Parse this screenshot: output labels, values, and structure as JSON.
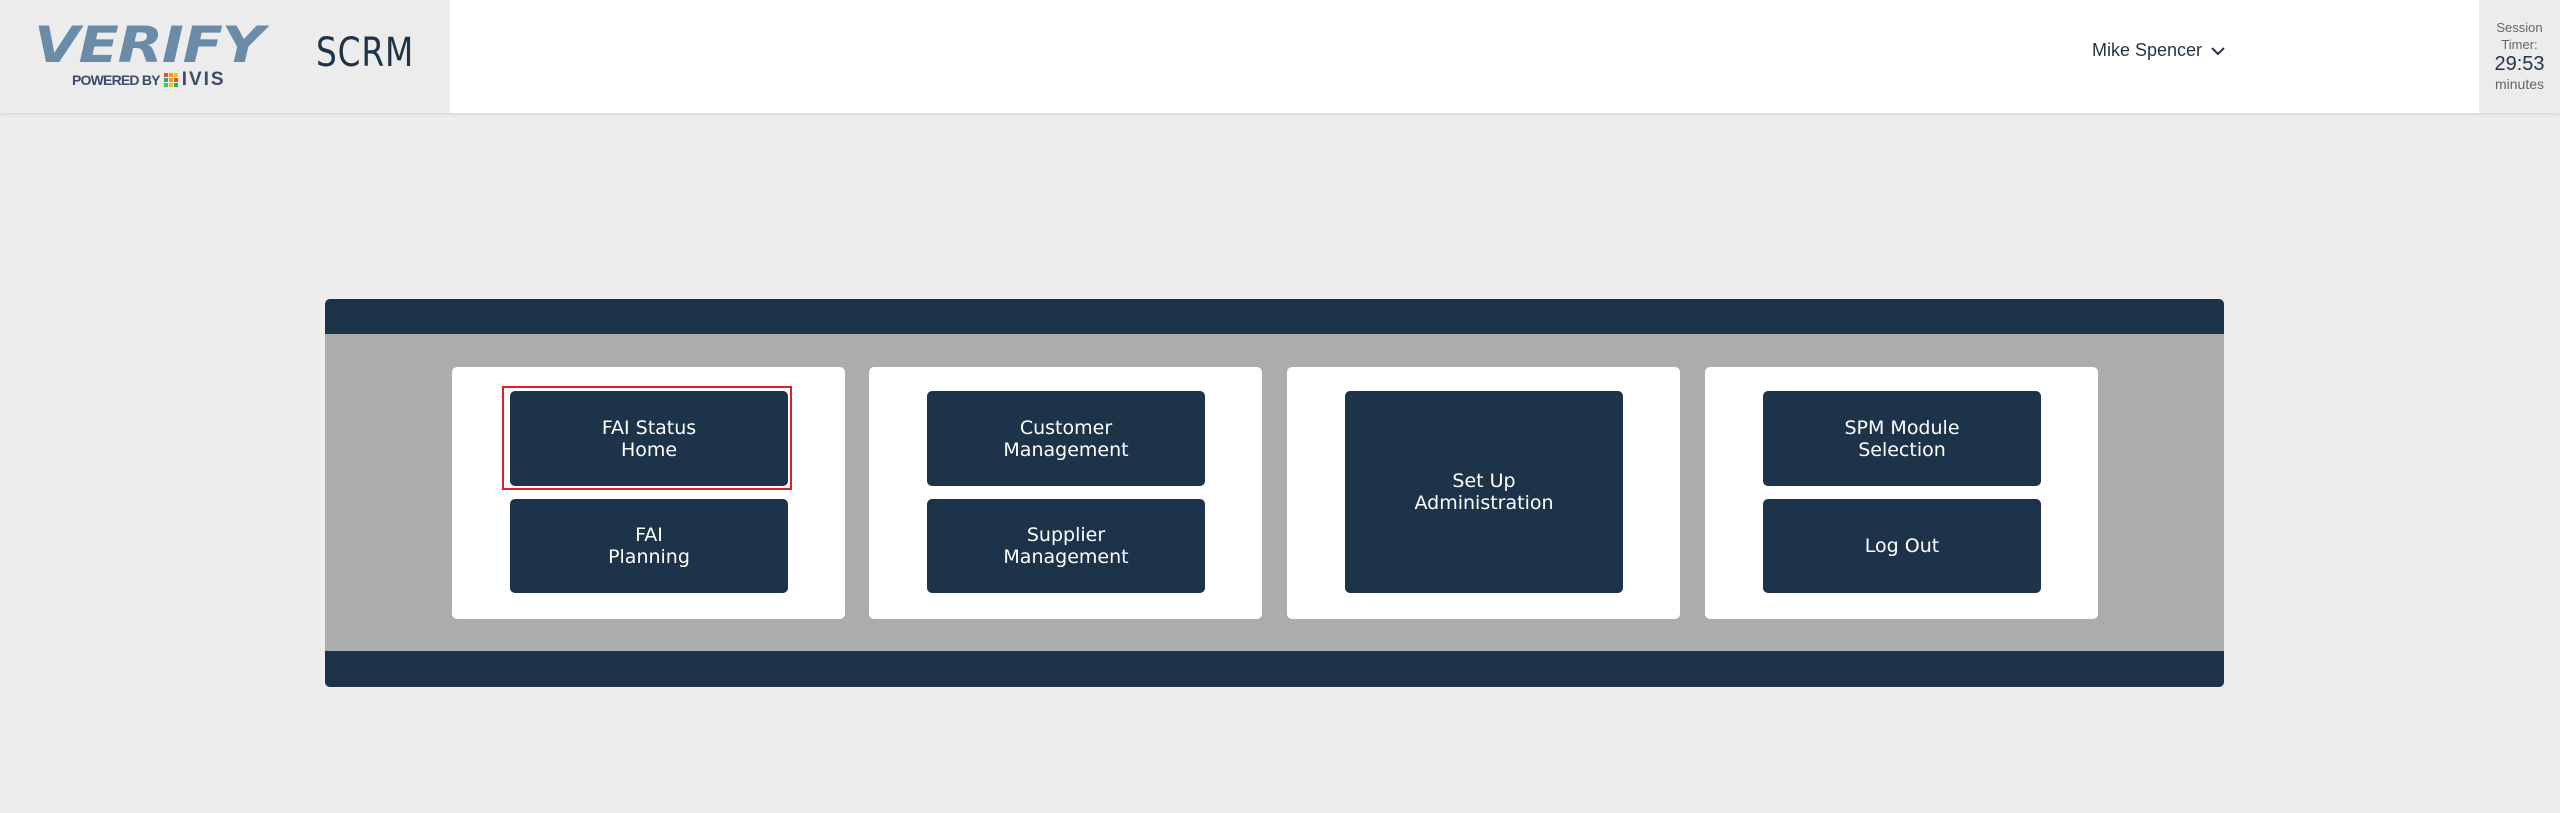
{
  "header": {
    "logo": {
      "wordmark": "VERIFY",
      "powered_by": "POWERED BY",
      "partner": "IVIS",
      "mark_colors": [
        "#e84c3d",
        "#f39c12",
        "#f1c40f",
        "#27ae60",
        "#f39c12",
        "#e84c3d",
        "#2ecc71",
        "#f1c40f",
        "#27ae60"
      ]
    },
    "app_name": "SCRM",
    "user": {
      "name": "Mike Spencer",
      "menu_icon": "chevron-down-icon"
    },
    "session": {
      "label_line1": "Session",
      "label_line2": "Timer:",
      "time": "29:53",
      "unit": "minutes"
    }
  },
  "menu": {
    "cards": [
      {
        "buttons": [
          {
            "line1": "FAI Status",
            "line2": "Home",
            "focused": true
          },
          {
            "line1": "FAI",
            "line2": "Planning"
          }
        ]
      },
      {
        "buttons": [
          {
            "line1": "Customer",
            "line2": "Management"
          },
          {
            "line1": "Supplier",
            "line2": "Management"
          }
        ]
      },
      {
        "buttons": [
          {
            "line1": "Set Up",
            "line2": "Administration"
          }
        ]
      },
      {
        "buttons": [
          {
            "line1": "SPM Module",
            "line2": "Selection"
          },
          {
            "line1": "Log Out",
            "line2": ""
          }
        ]
      }
    ]
  },
  "colors": {
    "primary": "#1c3349",
    "focus": "#e02027",
    "panel_bg": "#abacad",
    "page_bg": "#ededed"
  }
}
